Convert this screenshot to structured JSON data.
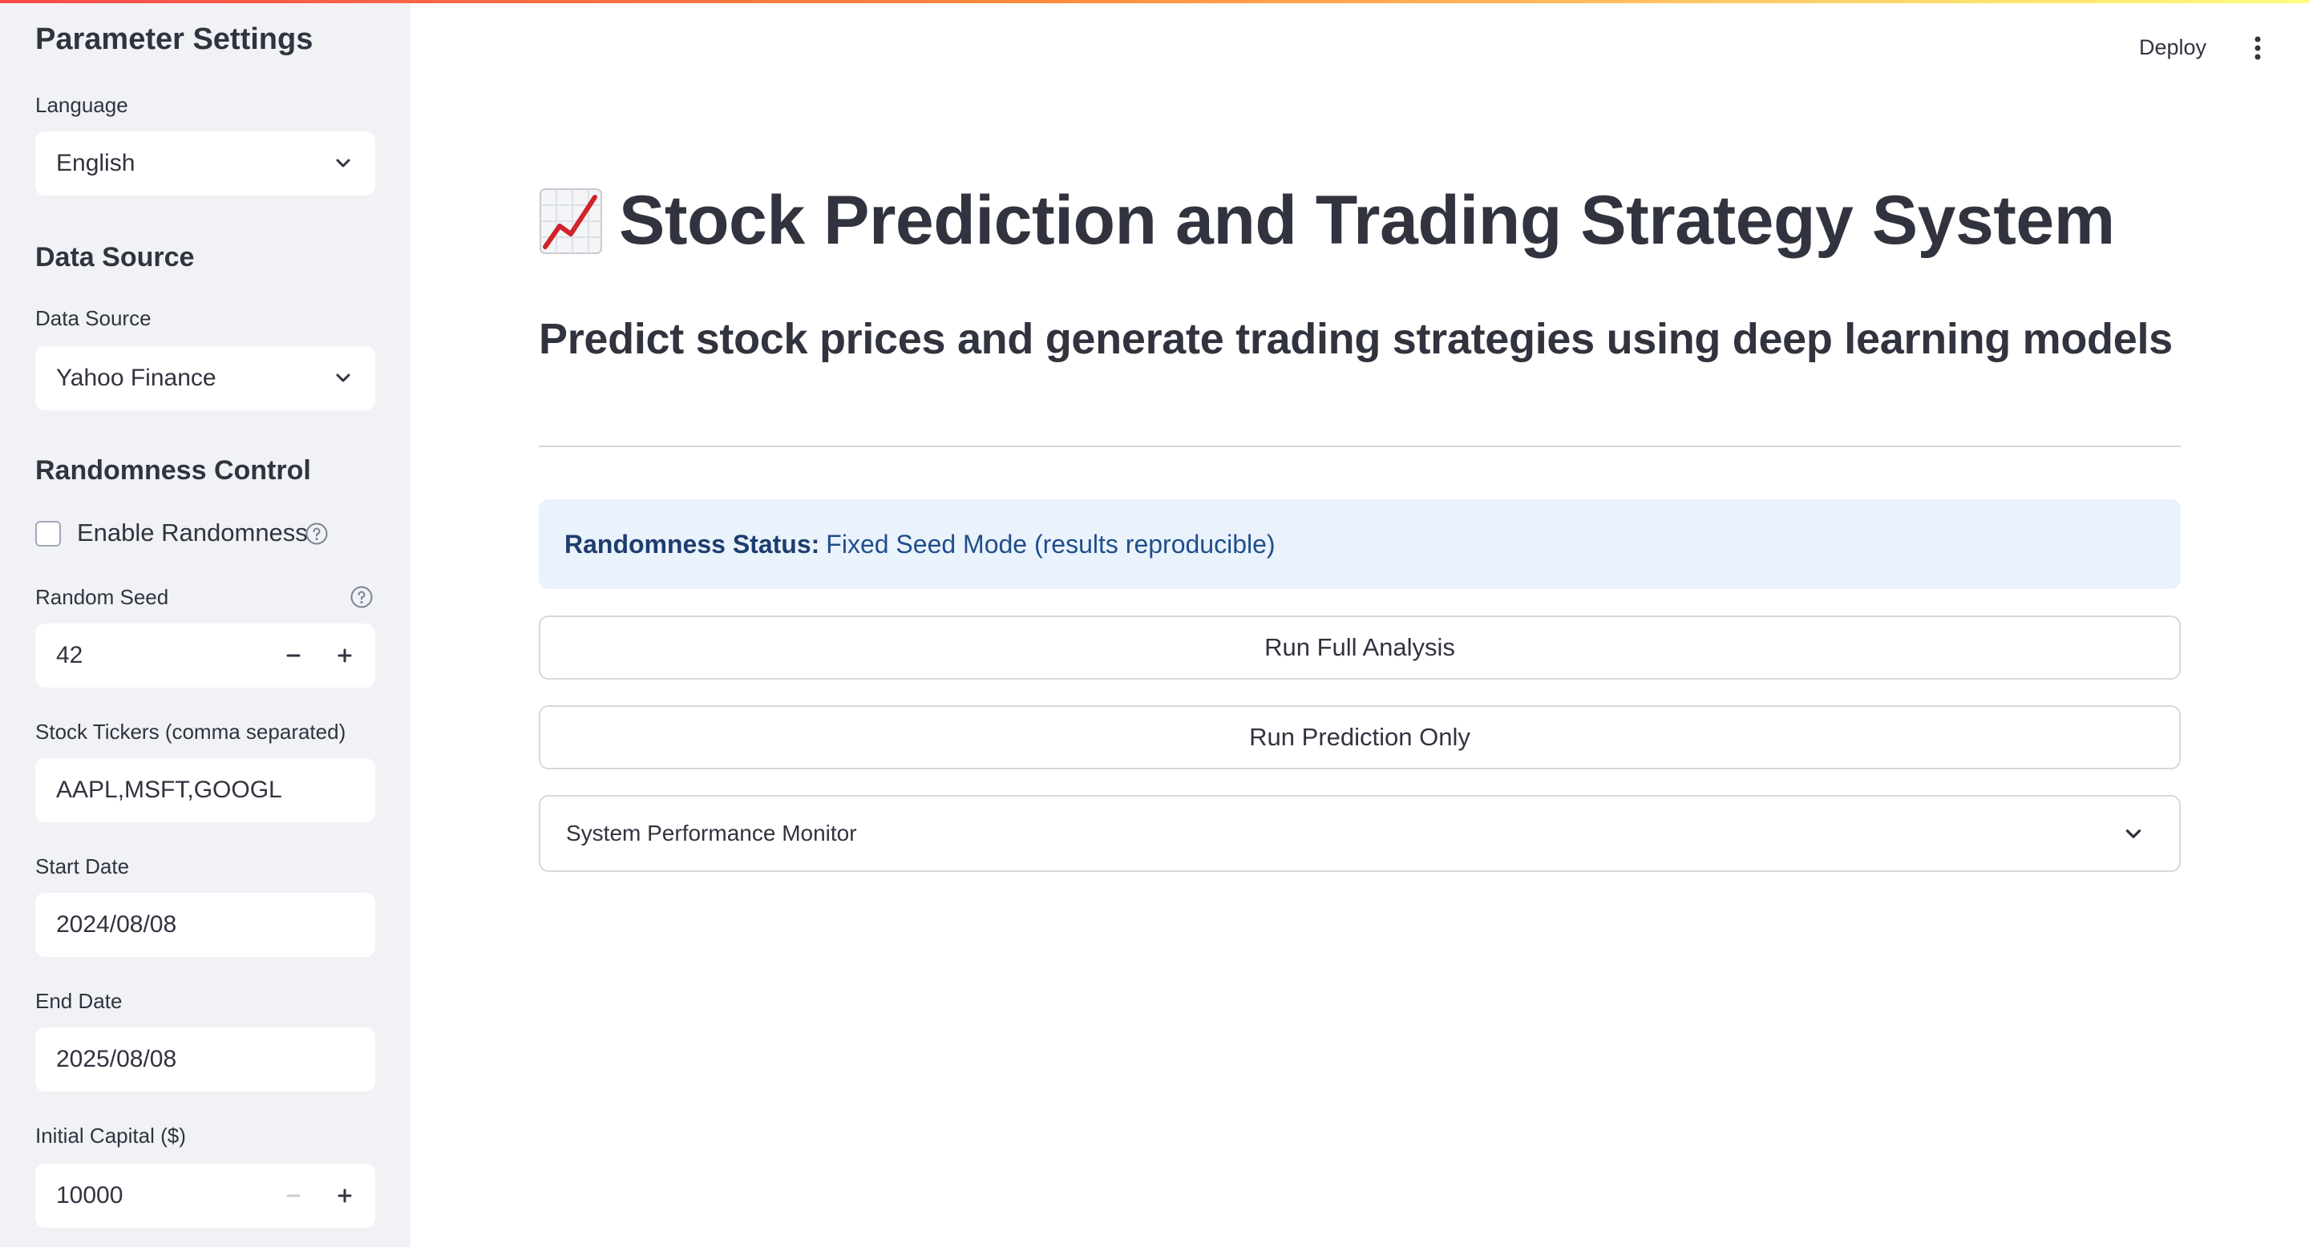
{
  "sidebar": {
    "title": "Parameter Settings",
    "language": {
      "label": "Language",
      "value": "English"
    },
    "data_source_header": "Data Source",
    "data_source": {
      "label": "Data Source",
      "value": "Yahoo Finance"
    },
    "randomness_header": "Randomness Control",
    "enable_randomness": {
      "label": "Enable Randomness",
      "checked": false
    },
    "random_seed": {
      "label": "Random Seed",
      "value": "42"
    },
    "tickers": {
      "label": "Stock Tickers (comma separated)",
      "value": "AAPL,MSFT,GOOGL"
    },
    "start_date": {
      "label": "Start Date",
      "value": "2024/08/08"
    },
    "end_date": {
      "label": "End Date",
      "value": "2025/08/08"
    },
    "initial_capital": {
      "label": "Initial Capital ($)",
      "value": "10000"
    }
  },
  "header": {
    "deploy_label": "Deploy"
  },
  "main": {
    "title": "Stock Prediction and Trading Strategy System",
    "subtitle": "Predict stock prices and generate trading strategies using deep learning models",
    "status_label": "Randomness Status:",
    "status_text": "Fixed Seed Mode (results reproducible)",
    "run_full_label": "Run Full Analysis",
    "run_prediction_label": "Run Prediction Only",
    "expander_label": "System Performance Monitor"
  },
  "icons": {
    "title_icon": "chart-increasing-icon",
    "select_icon": "chevron-down-icon",
    "help": "question-circle-icon",
    "menu": "kebab-menu-icon"
  },
  "colors": {
    "sidebar_bg": "#f0f2f6",
    "info_bg": "#eaf2fc",
    "info_text": "#1f4e8c",
    "accent": "#ff4b4b"
  }
}
